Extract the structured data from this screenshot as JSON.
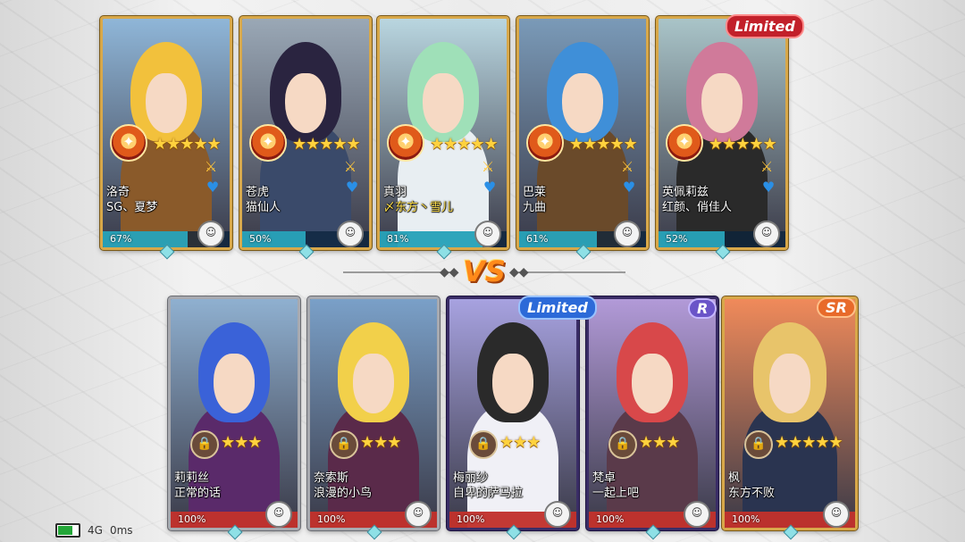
{
  "top_team": [
    {
      "name": "洛奇",
      "subtitle": "SG、夏梦",
      "subtitle_highlight": false,
      "progress_label": "67%",
      "progress": 0.67,
      "stars": 5,
      "frame": "gold",
      "hair": "#f2c13c",
      "body": "#8a5a2a",
      "bg": "#8fb6d8"
    },
    {
      "name": "苍虎",
      "subtitle": "猫仙人",
      "subtitle_highlight": false,
      "progress_label": "50%",
      "progress": 0.5,
      "stars": 5,
      "frame": "gold",
      "hair": "#2a2440",
      "body": "#3a4a6a",
      "bg": "#9aa8b6"
    },
    {
      "name": "真羽",
      "subtitle": "〆东方丶雪儿",
      "subtitle_highlight": true,
      "progress_label": "81%",
      "progress": 0.81,
      "stars": 5,
      "frame": "gold",
      "hair": "#9fe0b8",
      "body": "#e8eef2",
      "bg": "#b9d6e0"
    },
    {
      "name": "巴莱",
      "subtitle": "九曲",
      "subtitle_highlight": false,
      "progress_label": "61%",
      "progress": 0.61,
      "stars": 5,
      "frame": "gold",
      "hair": "#3f8fd8",
      "body": "#6a4a2a",
      "bg": "#7a9ab8"
    },
    {
      "name": "英佩莉兹",
      "subtitle": "红颜、俏佳人",
      "subtitle_highlight": false,
      "progress_label": "52%",
      "progress": 0.52,
      "stars": 5,
      "frame": "gold",
      "hair": "#d07a9a",
      "body": "#2a2a2a",
      "bg": "#a9c4c8"
    }
  ],
  "bottom_team": [
    {
      "name": "莉莉丝",
      "subtitle": "正常的话",
      "progress_label": "100%",
      "progress": 1.0,
      "stars": 3,
      "frame": "silver",
      "hair": "#3a62d8",
      "body": "#5a2a6a",
      "bg": "#8fb0d0"
    },
    {
      "name": "奈索斯",
      "subtitle": "浪漫的小鸟",
      "progress_label": "100%",
      "progress": 1.0,
      "stars": 3,
      "frame": "silver",
      "hair": "#f2d04a",
      "body": "#5a2a4a",
      "bg": "#7aa0c8"
    },
    {
      "name": "梅丽纱",
      "subtitle": "自卑的萨马拉",
      "progress_label": "100%",
      "progress": 1.0,
      "stars": 3,
      "frame": "purple",
      "hair": "#2a2a2a",
      "body": "#f0f0f6",
      "bg": "#a7a2e0"
    },
    {
      "name": "梵卓",
      "subtitle": "一起上吧",
      "progress_label": "100%",
      "progress": 1.0,
      "stars": 3,
      "frame": "purple",
      "hair": "#d8484a",
      "body": "#5a3a4a",
      "bg": "#b29ad8"
    },
    {
      "name": "枫",
      "subtitle": "东方不败",
      "progress_label": "100%",
      "progress": 1.0,
      "stars": 5,
      "frame": "gold",
      "hair": "#e8c46a",
      "body": "#2a3450",
      "bg": "#f08a5a"
    }
  ],
  "tags": {
    "limited_top": "Limited",
    "limited_bottom": "Limited",
    "rarity_r": "R",
    "rarity_sr": "SR"
  },
  "vs_label": "VS",
  "status_bar": {
    "network": "4G",
    "ping": "0ms",
    "battery_level": 0.75
  },
  "colors": {
    "top_progress": "#2bb3c9",
    "bottom_progress": "#d9342a",
    "star": "#ffd23e"
  },
  "icons": {
    "rank_badge": "flame-rank-badge-icon",
    "stance": "stance-face-icon",
    "weapon": "sword-icon",
    "guard": "heart-guard-icon",
    "lock": "lock-icon"
  }
}
